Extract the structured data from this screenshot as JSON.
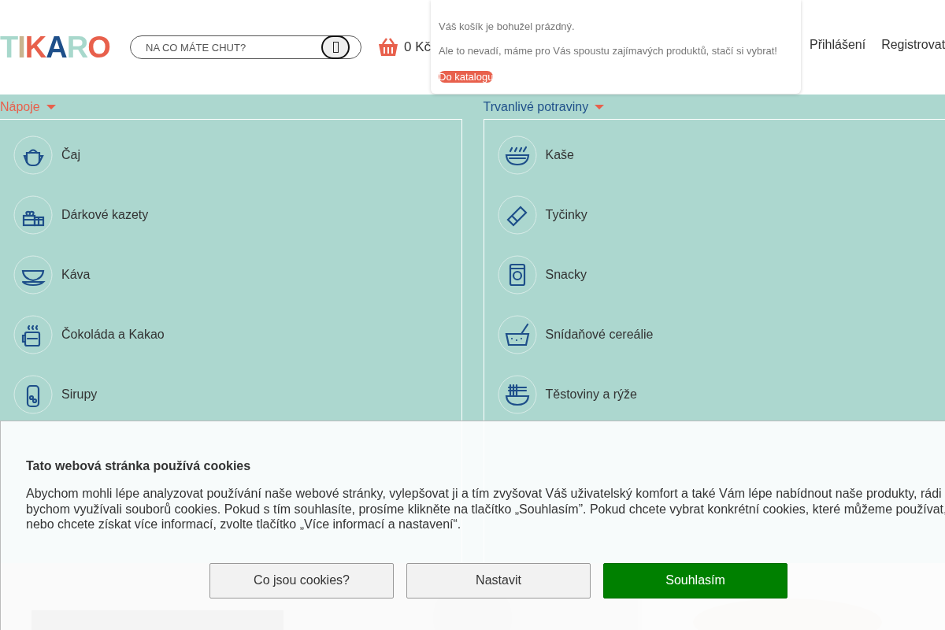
{
  "logo": {
    "letters": [
      {
        "char": "T",
        "color": "#a8d8cc"
      },
      {
        "char": "I",
        "color": "#c9b48f"
      },
      {
        "char": "K",
        "color": "#e8604c"
      },
      {
        "char": "A",
        "color": "#1e4f8a"
      },
      {
        "char": "R",
        "color": "#a8d8cc"
      },
      {
        "char": "O",
        "color": "#e8604c"
      }
    ]
  },
  "search": {
    "placeholder": "NA CO MÁTE CHUT?"
  },
  "cart": {
    "total": "0 Kč"
  },
  "cart_popup": {
    "lines": [
      "Váš košík je bohužel prázdný.",
      "Ale to nevadí, máme pro Vás spoustu zajímavých produktů, stačí si vybrat!"
    ],
    "button": "Do katalogu"
  },
  "account_links": [
    "Přihlášení",
    "Registrovat"
  ],
  "menu": [
    {
      "title": "Nápoje",
      "selected": true,
      "items": [
        "Čaj",
        "Dárkové kazety",
        "Káva",
        "Čokoláda a Kakao",
        "Sirupy"
      ]
    },
    {
      "title": "Trvanlivé potraviny",
      "selected": false,
      "items": [
        "Kaše",
        "Tyčinky",
        "Snacky",
        "Snídaňové cereálie",
        "Těstoviny a rýže"
      ]
    }
  ],
  "banner": {
    "kind": "picture"
  },
  "cookies": {
    "title": "Tato webová stránka používá cookies",
    "text": "Abychom mohli lépe analyzovat používání naše webové stránky, vylepšovat ji a tím zvyšovat Váš uživatelský komfort a také Vám lépe nabídnout naše produkty, rádi bychom využívali souborů cookies. Pokud s tím souhlasíte, prosíme klikněte na tlačítko „Souhlasím”. Pokud chcete vybrat konkrétní cookies, které můžeme používat, nebo chcete získat více informací, zvolte tlačítko „Více informací a nastavení“.",
    "buttons": [
      {
        "label": "Co jsou cookies?",
        "primary": false
      },
      {
        "label": "Nastavit",
        "primary": false
      },
      {
        "label": "Souhlasím",
        "primary": true
      }
    ]
  }
}
